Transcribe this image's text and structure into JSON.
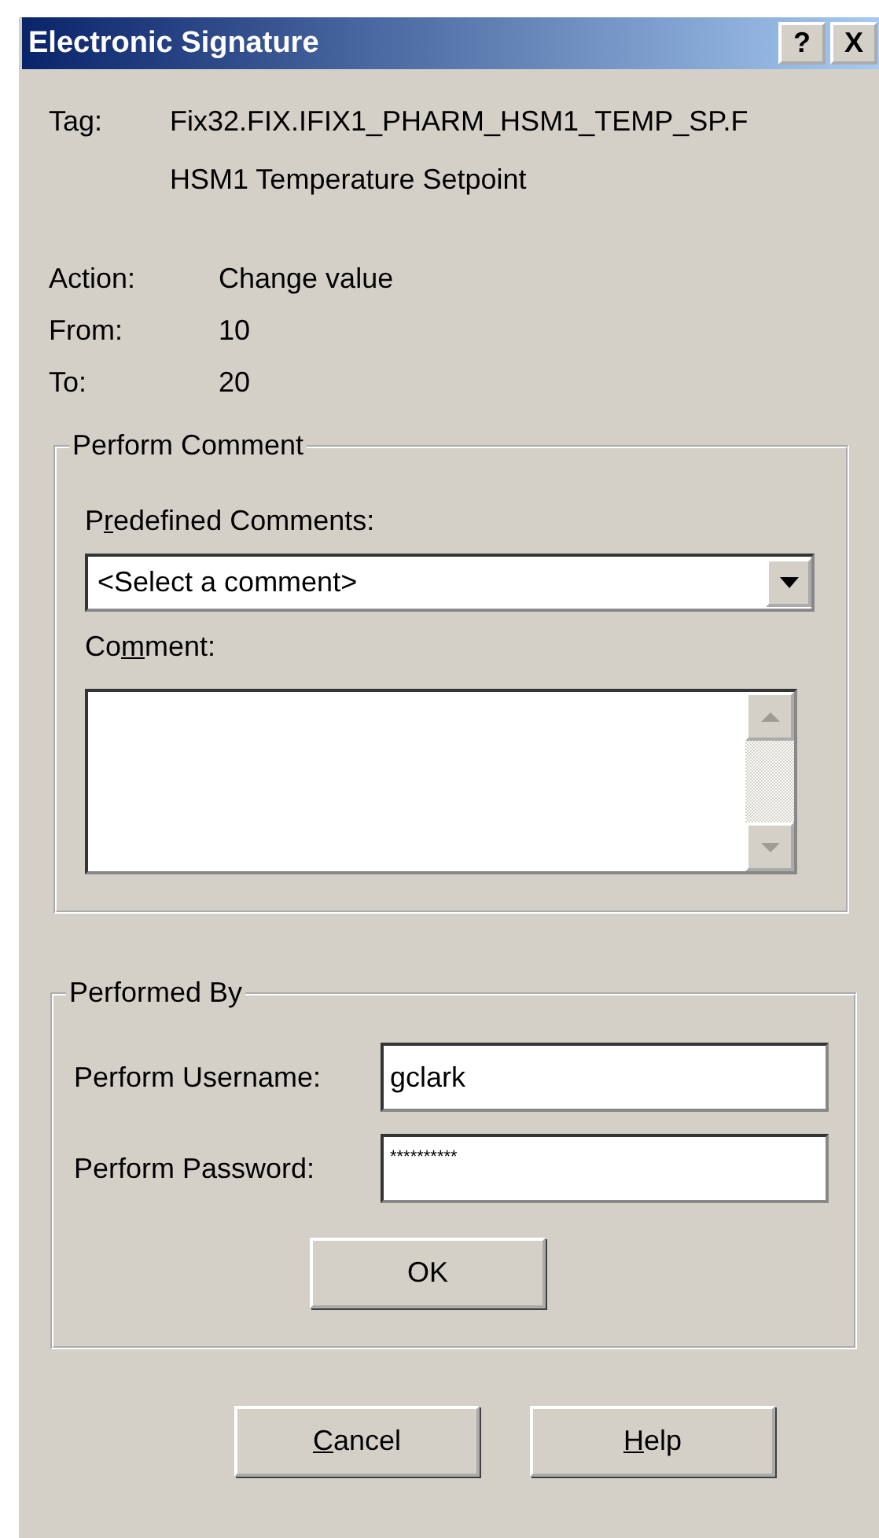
{
  "window": {
    "title": "Electronic Signature",
    "title_buttons": [
      "?",
      "X"
    ]
  },
  "tag": {
    "label": "Tag:",
    "value": "Fix32.FIX.IFIX1_PHARM_HSM1_TEMP_SP.F",
    "description": "HSM1 Temperature Setpoint"
  },
  "details": [
    {
      "label": "Action:",
      "value": "Change value"
    },
    {
      "label": "From:",
      "value": "10"
    },
    {
      "label": "To:",
      "value": "20"
    }
  ],
  "perform_comment": {
    "title": "Perform Comment",
    "predefined_label": [
      "P",
      "r",
      "edefined Comments:"
    ],
    "predefined_value": "<Select a comment>",
    "comment_label": [
      "Co",
      "m",
      "ment:"
    ]
  },
  "performed_by": {
    "title": "Performed By",
    "username_label": "Perform Username:",
    "username": "gclark",
    "password_label": "Perform Password:",
    "password": "**********",
    "ok": "OK"
  },
  "buttons": [
    {
      "key": "C",
      "rest": "ancel"
    },
    {
      "key": "H",
      "rest": "elp"
    }
  ]
}
